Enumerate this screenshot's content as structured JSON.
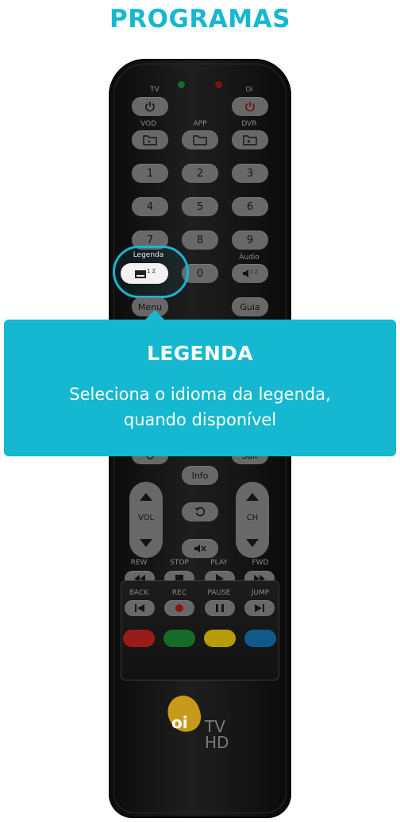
{
  "page": {
    "title": "PROGRAMAS"
  },
  "tooltip": {
    "title": "LEGENDA",
    "line1": "Seleciona o idioma da legenda,",
    "line2": "quando disponível"
  },
  "remote": {
    "labels": {
      "tv": "TV",
      "oi": "Oi",
      "vod": "VOD",
      "app": "APP",
      "dvr": "DVR",
      "legenda": "Legenda",
      "audio": "Áudio",
      "rew": "REW",
      "stop": "STOP",
      "play": "PLAY",
      "fwd": "FWD",
      "back": "BACK",
      "rec": "REC",
      "pause": "PAUSE",
      "jump": "JUMP"
    },
    "keys": {
      "k1": "1",
      "k2": "2",
      "k3": "3",
      "k4": "4",
      "k5": "5",
      "k6": "6",
      "k7": "7",
      "k8": "8",
      "k9": "9",
      "k0": "0",
      "menu": "Menu",
      "guia": "Guia",
      "sair": "Sair",
      "info": "Info",
      "vol": "VOL",
      "ch": "CH"
    },
    "logo": {
      "brand": "oi",
      "line1": "TV",
      "line2": "HD"
    },
    "colors": {
      "accent": "#15b8d0",
      "red": "#9b1b1b",
      "green": "#176b2a",
      "yellow": "#b59c08",
      "blue": "#0f5a8a"
    }
  }
}
